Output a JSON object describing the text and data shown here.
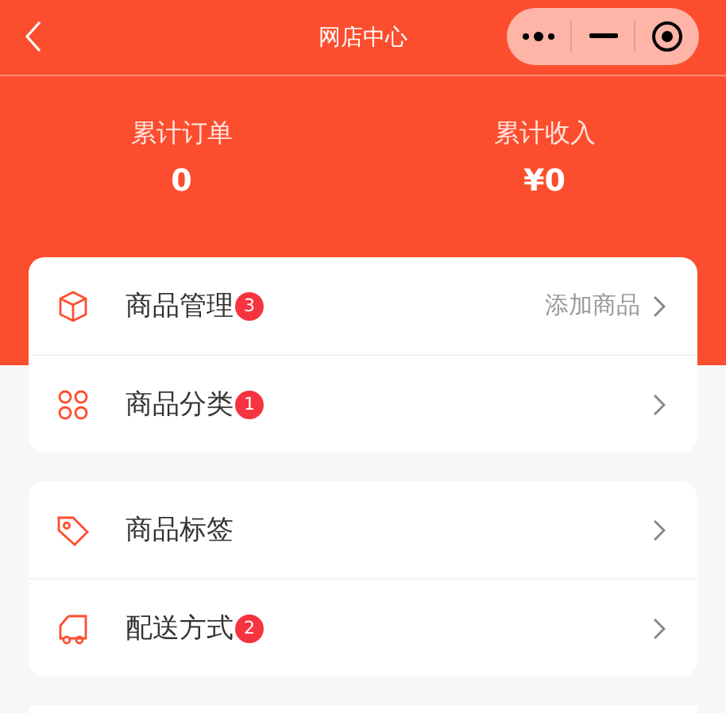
{
  "nav": {
    "title": "网店中心"
  },
  "stats": [
    {
      "label": "累计订单",
      "value": "0"
    },
    {
      "label": "累计收入",
      "value": "¥0"
    }
  ],
  "groups": [
    {
      "rows": [
        {
          "label": "商品管理",
          "badge": "3",
          "extra": "添加商品"
        },
        {
          "label": "商品分类",
          "badge": "1"
        }
      ]
    },
    {
      "rows": [
        {
          "label": "商品标签"
        },
        {
          "label": "配送方式",
          "badge": "2"
        }
      ]
    }
  ]
}
